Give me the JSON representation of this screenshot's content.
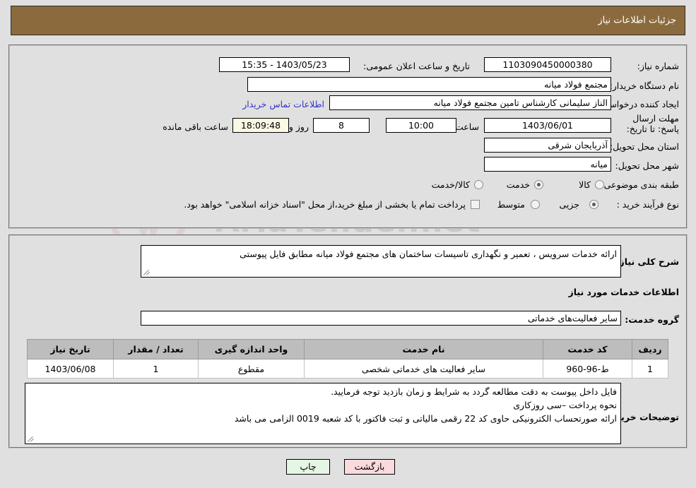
{
  "header": {
    "title": "جزئیات اطلاعات نیاز"
  },
  "form": {
    "need_number_label": "شماره نیاز:",
    "need_number_value": "1103090450000380",
    "announce_datetime_label": "تاریخ و ساعت اعلان عمومی:",
    "announce_datetime_value": "1403/05/23 - 15:35",
    "buyer_org_label": "نام دستگاه خریدار:",
    "buyer_org_value": "مجتمع فولاد میانه",
    "creator_label": "ایجاد کننده درخواست:",
    "creator_value": "الناز سلیمانی کارشناس تامین مجتمع فولاد میانه",
    "contact_link": "اطلاعات تماس خریدار",
    "deadline_label": "مهلت ارسال پاسخ: تا تاریخ:",
    "deadline_date": "1403/06/01",
    "hour_label": "ساعت",
    "hour_value": "10:00",
    "days_value": "8",
    "days_label": "روز و",
    "countdown_value": "18:09:48",
    "countdown_label": "ساعت باقی مانده",
    "province_label": "استان محل تحویل:",
    "province_value": "آذربایجان شرقی",
    "city_label": "شهر محل تحویل:",
    "city_value": "میانه",
    "category_label": "طبقه بندی موضوعی:",
    "category_options": [
      {
        "label": "کالا",
        "checked": false
      },
      {
        "label": "خدمت",
        "checked": true
      },
      {
        "label": "کالا/خدمت",
        "checked": false
      }
    ],
    "process_label": "نوع فرآیند خرید :",
    "process_options": [
      {
        "label": "جزیی",
        "checked": true
      },
      {
        "label": "متوسط",
        "checked": false
      }
    ],
    "treasury_checkbox_checked": false,
    "treasury_text": "پرداخت تمام یا بخشی از مبلغ خرید،از محل \"اسناد خزانه اسلامی\" خواهد بود."
  },
  "details": {
    "summary_label": "شرح کلی نیاز:",
    "summary_value": "ارائه خدمات سرویس ، تعمیر و نگهداری تاسیسات ساختمان های مجتمع فولاد میانه مطابق فایل پیوستی",
    "section_title": "اطلاعات خدمات مورد نیاز",
    "service_group_label": "گروه خدمت:",
    "service_group_value": "سایر فعالیت‌های خدماتی",
    "buyer_notes_label": "توضیحات خریدار:",
    "buyer_notes_lines": [
      "فایل داخل پیوست به دقت مطالعه گردد به شرایط و زمان بازدید توجه فرمایید.",
      "نحوه پرداخت –سی روزکاری",
      "ارائه صورتحساب الکترونیکی حاوی کد 22 رقمی مالیاتی و ثبت فاکتور با کد شعبه 0019 الزامی می باشد"
    ]
  },
  "table": {
    "columns": [
      "ردیف",
      "کد خدمت",
      "نام خدمت",
      "واحد اندازه گیری",
      "تعداد / مقدار",
      "تاریخ نیاز"
    ],
    "rows": [
      {
        "row_no": "1",
        "service_code": "ط-96-960",
        "service_name": "سایر فعالیت های خدماتی شخصی",
        "unit": "مقطوع",
        "quantity": "1",
        "need_date": "1403/06/08"
      }
    ]
  },
  "buttons": {
    "print": "چاپ",
    "back": "بازگشت"
  },
  "watermark": {
    "text": "AriaTender.net"
  },
  "colors": {
    "header_bar": "#8b6b3d",
    "page_bg": "#e0e0e0",
    "link": "#3333cc",
    "table_header": "#bdbdbd",
    "countdown_bg": "#fbf8e3",
    "print_btn": "#e6f6e4",
    "back_btn": "#fadadd"
  }
}
